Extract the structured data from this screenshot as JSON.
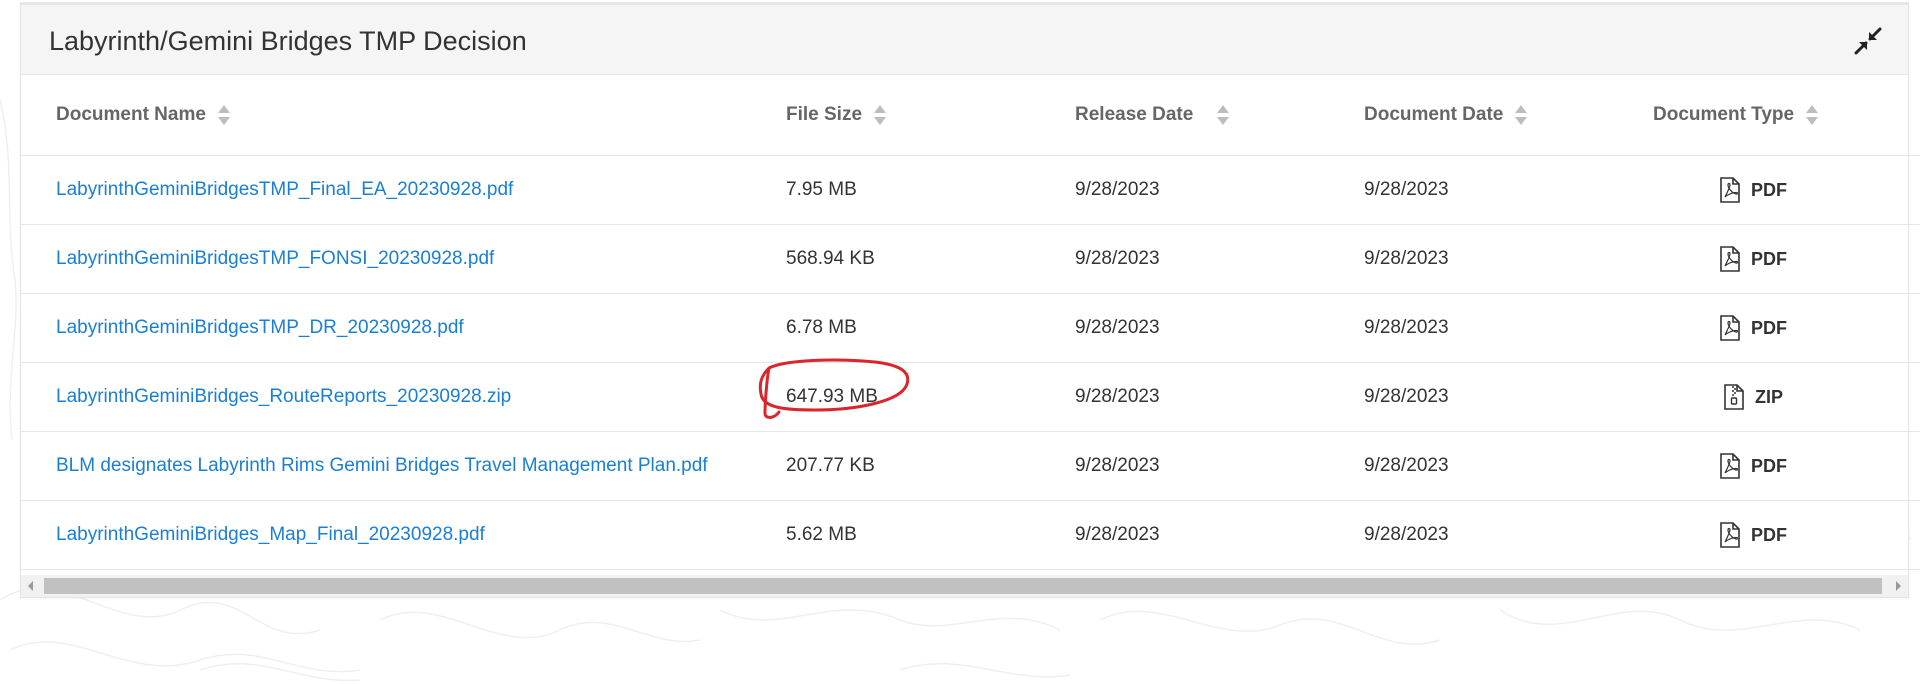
{
  "panel": {
    "title": "Labyrinth/Gemini Bridges TMP Decision",
    "collapse_icon": "compress-arrows-icon"
  },
  "table": {
    "headers": [
      "Document Name",
      "File Size",
      "Release Date",
      "Document Date",
      "Document Type"
    ],
    "rows": [
      {
        "name": "LabyrinthGeminiBridgesTMP_Final_EA_20230928.pdf",
        "size": "7.95 MB",
        "release": "9/28/2023",
        "date": "9/28/2023",
        "type": "PDF",
        "icon": "pdf-file-icon"
      },
      {
        "name": "LabyrinthGeminiBridgesTMP_FONSI_20230928.pdf",
        "size": "568.94 KB",
        "release": "9/28/2023",
        "date": "9/28/2023",
        "type": "PDF",
        "icon": "pdf-file-icon"
      },
      {
        "name": "LabyrinthGeminiBridgesTMP_DR_20230928.pdf",
        "size": "6.78 MB",
        "release": "9/28/2023",
        "date": "9/28/2023",
        "type": "PDF",
        "icon": "pdf-file-icon"
      },
      {
        "name": "LabyrinthGeminiBridges_RouteReports_20230928.zip",
        "size": "647.93 MB",
        "release": "9/28/2023",
        "date": "9/28/2023",
        "type": "ZIP",
        "icon": "zip-file-icon"
      },
      {
        "name": "BLM designates Labyrinth Rims Gemini Bridges Travel Management Plan.pdf",
        "size": "207.77 KB",
        "release": "9/28/2023",
        "date": "9/28/2023",
        "type": "PDF",
        "icon": "pdf-file-icon"
      },
      {
        "name": "LabyrinthGeminiBridges_Map_Final_20230928.pdf",
        "size": "5.62 MB",
        "release": "9/28/2023",
        "date": "9/28/2023",
        "type": "PDF",
        "icon": "pdf-file-icon"
      }
    ]
  },
  "colors": {
    "link": "#1a7fd4",
    "annotation": "#d9262c",
    "header_bg": "#f5f5f5"
  }
}
